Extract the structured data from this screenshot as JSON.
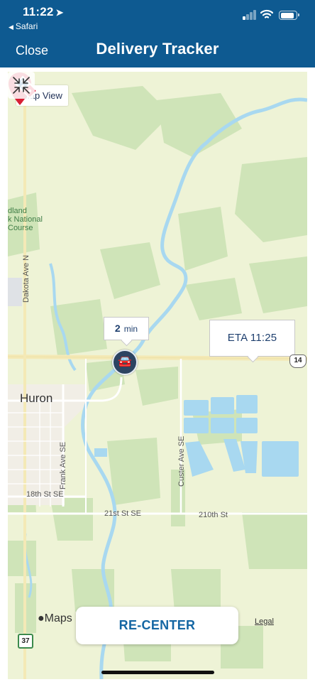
{
  "status_bar": {
    "time": "11:22",
    "location_icon": "location-arrow-icon",
    "back_app": "Safari",
    "icons": [
      "cellular-signal-icon",
      "wifi-icon",
      "battery-icon"
    ]
  },
  "header": {
    "close_label": "Close",
    "title": "Delivery Tracker",
    "background": "#0e5a91"
  },
  "map": {
    "view_button_label": "Map View",
    "driver_eta": {
      "value": "2",
      "unit": "min"
    },
    "driver_icon": "delivery-car-icon",
    "destination_eta": "ETA 11:25",
    "destination_icon": "map-pin-icon",
    "store_icon": "dominos-logo-icon",
    "labels": {
      "town": "Huron",
      "park": "dland\nk National\nCourse",
      "dakota_ave": "Dakota Ave N",
      "frank_ave": "Frank Ave SE",
      "custer_ave": "Custer Ave SE",
      "street_18th": "18th St SE",
      "street_21st": "21st St SE",
      "street_210th": "210th St"
    },
    "highway_14": "14",
    "highway_37": "37",
    "maps_brand": "Maps",
    "legal_label": "Legal",
    "collapse_icon": "collapse-arrows-icon",
    "colors": {
      "land": "#eef3d6",
      "park": "#cfe4b8",
      "water": "#a8d8f0",
      "accent_pin": "#d81f35"
    }
  },
  "footer": {
    "recenter_label": "RE-CENTER"
  }
}
